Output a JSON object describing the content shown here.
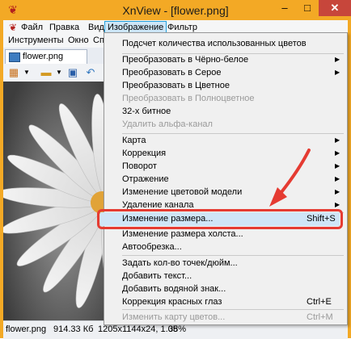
{
  "window": {
    "title": "XnView - [flower.png]",
    "app_icon": "xnview-logo-icon",
    "min_glyph": "–",
    "max_glyph": "□",
    "close_glyph": "✕"
  },
  "menubar": {
    "row1": [
      "Файл",
      "Правка",
      "Вид",
      "Изображение",
      "Фильтр"
    ],
    "row2": [
      "Инструменты",
      "Окно",
      "Сп"
    ]
  },
  "tab": {
    "label": "flower.png"
  },
  "toolbar": {
    "icons": [
      "ruler-icon",
      "dropdown-icon",
      "folder-icon",
      "dropdown-icon",
      "save-icon",
      "rotate-icon"
    ]
  },
  "statusbar": {
    "filename": "flower.png",
    "filesize": "914.33 Кб",
    "dimensions": "1205x1144x24, 1.05",
    "zoom": "38%"
  },
  "image_menu": {
    "items": [
      {
        "label": "Подсчет количества использованных цветов",
        "submenu": false,
        "disabled": false,
        "shortcut": ""
      },
      {
        "separator": true
      },
      {
        "label": "Преобразовать в Чёрно-белое",
        "submenu": true,
        "disabled": false,
        "shortcut": ""
      },
      {
        "label": "Преобразовать в Серое",
        "submenu": true,
        "disabled": false,
        "shortcut": ""
      },
      {
        "label": "Преобразовать в Цветное",
        "submenu": false,
        "disabled": false,
        "shortcut": ""
      },
      {
        "label": "Преобразовать в Полноцветное",
        "submenu": false,
        "disabled": true,
        "shortcut": ""
      },
      {
        "label": "32-х битное",
        "submenu": false,
        "disabled": false,
        "shortcut": ""
      },
      {
        "label": "Удалить альфа-канал",
        "submenu": false,
        "disabled": true,
        "shortcut": ""
      },
      {
        "separator": true
      },
      {
        "label": "Карта",
        "submenu": true,
        "disabled": false,
        "shortcut": ""
      },
      {
        "label": "Коррекция",
        "submenu": true,
        "disabled": false,
        "shortcut": ""
      },
      {
        "label": "Поворот",
        "submenu": true,
        "disabled": false,
        "shortcut": ""
      },
      {
        "label": "Отражение",
        "submenu": true,
        "disabled": false,
        "shortcut": ""
      },
      {
        "label": "Изменение цветовой модели",
        "submenu": true,
        "disabled": false,
        "shortcut": ""
      },
      {
        "label": "Удаление канала",
        "submenu": true,
        "disabled": false,
        "shortcut": ""
      },
      {
        "separator": true
      },
      {
        "label": "Изменение размера...",
        "submenu": false,
        "disabled": false,
        "shortcut": "Shift+S",
        "highlighted": true
      },
      {
        "label": "Изменение размера холста...",
        "submenu": false,
        "disabled": false,
        "shortcut": ""
      },
      {
        "label": "Автообрезка...",
        "submenu": false,
        "disabled": false,
        "shortcut": ""
      },
      {
        "separator": true
      },
      {
        "label": "Задать кол-во точек/дюйм...",
        "submenu": false,
        "disabled": false,
        "shortcut": ""
      },
      {
        "label": "Добавить текст...",
        "submenu": false,
        "disabled": false,
        "shortcut": ""
      },
      {
        "label": "Добавить водяной знак...",
        "submenu": false,
        "disabled": false,
        "shortcut": ""
      },
      {
        "label": "Коррекция красных глаз",
        "submenu": false,
        "disabled": false,
        "shortcut": "Ctrl+E"
      },
      {
        "separator": true
      },
      {
        "label": "Изменить карту цветов...",
        "submenu": false,
        "disabled": true,
        "shortcut": "Ctrl+M"
      }
    ]
  },
  "colors": {
    "titlebar": "#f3a925",
    "close_button": "#c7463b",
    "highlight_border": "#e53b32",
    "annotation_arrow": "#e53b32",
    "menu_hover": "#cde6f7"
  }
}
